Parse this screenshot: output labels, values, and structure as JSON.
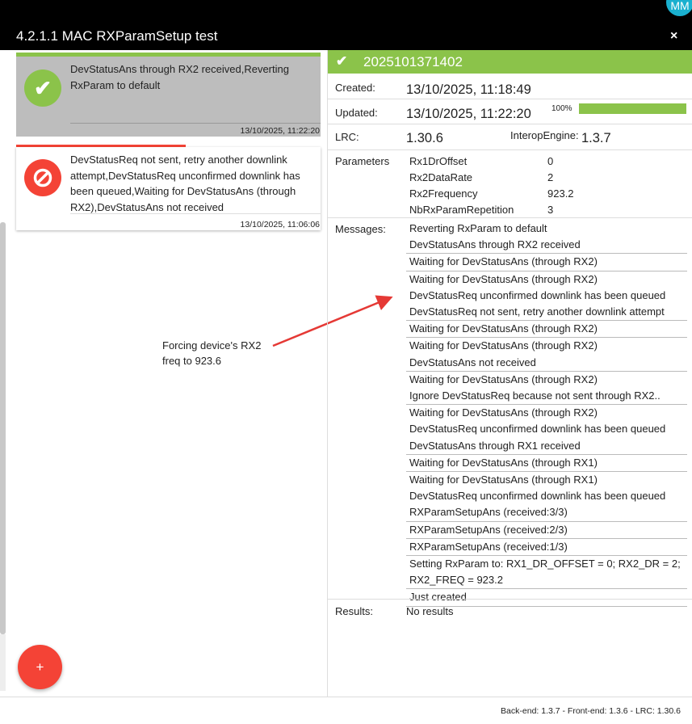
{
  "window": {
    "title": "4.2.1.1 MAC RXParamSetup test",
    "close_label": "×"
  },
  "user": {
    "initials": "MM"
  },
  "left_panel": {
    "cards": [
      {
        "status": "success",
        "icon": "check-icon",
        "text": "DevStatusAns through RX2 received,Reverting RxParam to default",
        "date": "13/10/2025, 11:22:20"
      },
      {
        "status": "error",
        "icon": "block-icon",
        "text": "DevStatusReq not sent, retry another downlink attempt,DevStatusReq unconfirmed downlink has been queued,Waiting for DevStatusAns (through RX2),DevStatusAns not received",
        "date": "13/10/2025, 11:06:06"
      }
    ],
    "fab_label": "+",
    "annotation": [
      "Forcing device's RX2",
      "freq to 923.6"
    ]
  },
  "detail": {
    "id": "2025101371402",
    "created_label": "Created:",
    "created": "13/10/2025, 11:18:49",
    "updated_label": "Updated:",
    "updated": "13/10/2025, 11:22:20",
    "progress_label": "100%",
    "progress": 1.0,
    "lrc_label": "LRC:",
    "lrc": "1.30.6",
    "interop_label": "InteropEngine:",
    "interop": "1.3.7",
    "parameters_label": "Parameters",
    "parameters": [
      {
        "key": "Rx1DrOffset",
        "value": "0"
      },
      {
        "key": "Rx2DataRate",
        "value": "2"
      },
      {
        "key": "Rx2Frequency",
        "value": "923.2"
      },
      {
        "key": "NbRxParamRepetition",
        "value": "3"
      }
    ],
    "messages_label": "Messages:",
    "messages": [
      "Reverting RxParam to default",
      "DevStatusAns through RX2 received",
      "Waiting for DevStatusAns (through RX2)",
      "Waiting for DevStatusAns (through RX2)",
      "DevStatusReq unconfirmed downlink has been queued",
      "DevStatusReq not sent, retry another downlink attempt",
      "Waiting for DevStatusAns (through RX2)",
      "Waiting for DevStatusAns (through RX2)",
      "DevStatusAns not received",
      "Waiting for DevStatusAns (through RX2)",
      "Ignore DevStatusReq because not sent through RX2..",
      "Waiting for DevStatusAns (through RX2)",
      "DevStatusReq unconfirmed downlink has been queued",
      "DevStatusAns through RX1 received",
      "Waiting for DevStatusAns (through RX1)",
      "Waiting for DevStatusAns (through RX1)",
      "DevStatusReq unconfirmed downlink has been queued",
      "RXParamSetupAns (received:3/3)",
      "RXParamSetupAns (received:2/3)",
      "RXParamSetupAns (received:1/3)",
      "Setting RxParam to: RX1_DR_OFFSET = 0; RX2_DR = 2; RX2_FREQ = 923.2",
      "Just created"
    ],
    "results_label": "Results:",
    "results": "No results"
  },
  "footer": {
    "versions": "Back-end: 1.3.7 - Front-end: 1.3.6 - LRC: 1.30.6"
  }
}
